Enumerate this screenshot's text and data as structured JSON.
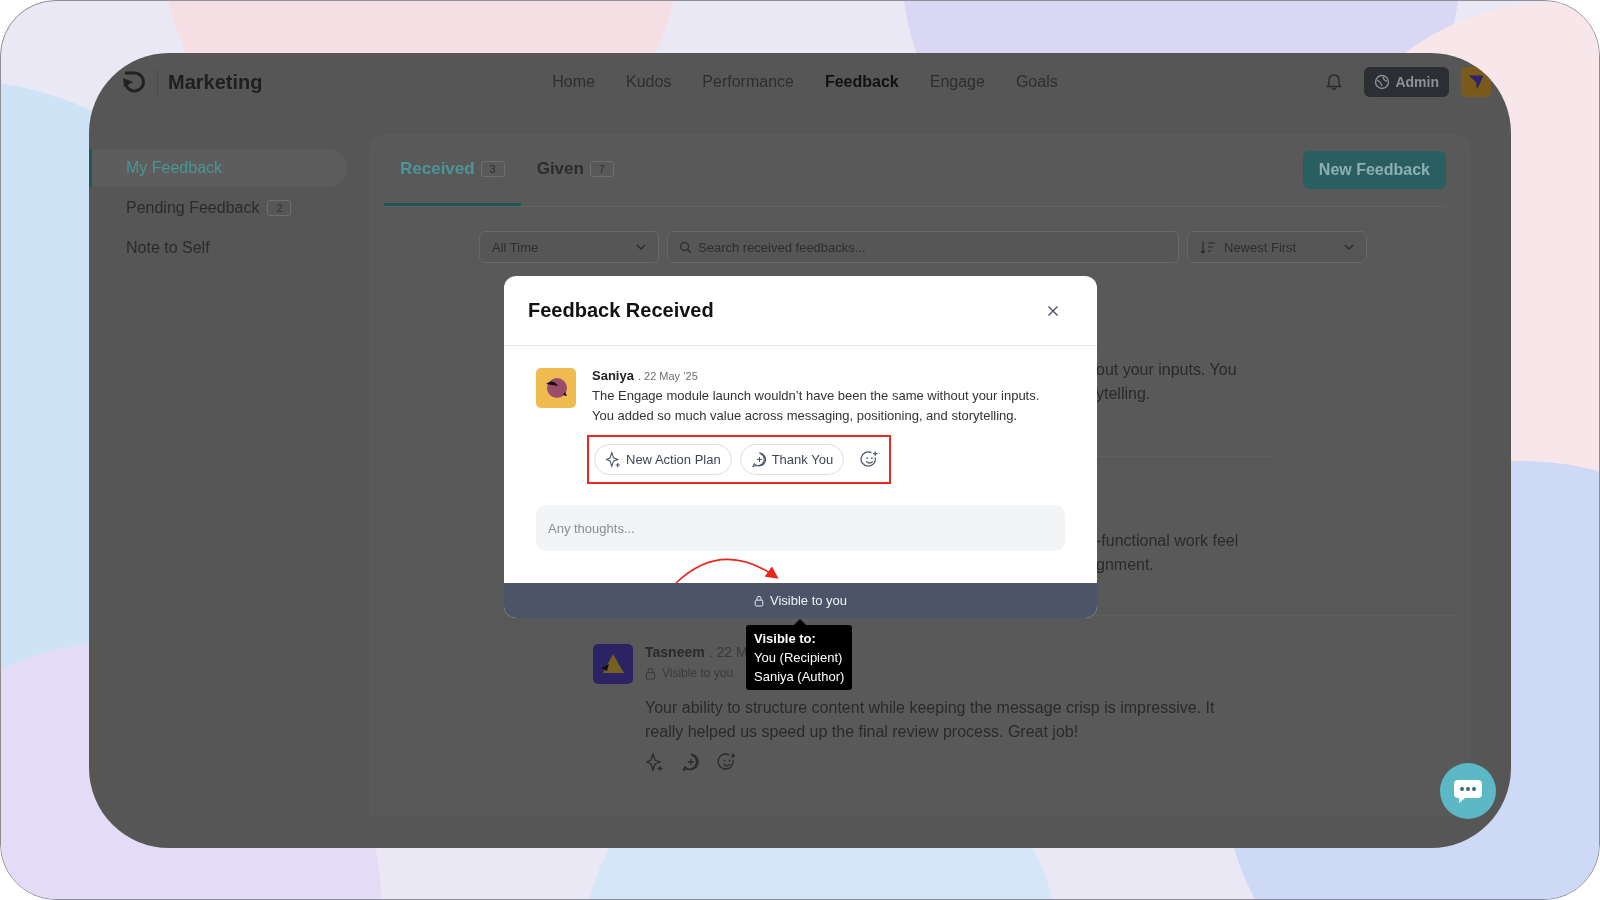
{
  "app": {
    "title": "Marketing",
    "admin_label": "Admin"
  },
  "nav": [
    {
      "label": "Home",
      "selected": false
    },
    {
      "label": "Kudos",
      "selected": false
    },
    {
      "label": "Performance",
      "selected": false
    },
    {
      "label": "Feedback",
      "selected": true
    },
    {
      "label": "Engage",
      "selected": false
    },
    {
      "label": "Goals",
      "selected": false
    }
  ],
  "sidebar": {
    "items": [
      {
        "label": "My Feedback",
        "selected": true
      },
      {
        "label": "Pending Feedback",
        "badge": "2",
        "selected": false
      },
      {
        "label": "Note to Self",
        "selected": false
      }
    ]
  },
  "tabs": [
    {
      "label": "Received",
      "count": "3",
      "selected": true
    },
    {
      "label": "Given",
      "count": "7",
      "selected": false
    }
  ],
  "new_feedback_button": "New Feedback",
  "filters": {
    "period": "All Time",
    "search_placeholder": "Search received feedbacks...",
    "sort": "Newest First"
  },
  "feed": {
    "fragments": [
      [
        "out your inputs. You",
        "ytelling."
      ],
      [
        "-functional work feel",
        "gnment."
      ]
    ],
    "item": {
      "author": "Tasneem",
      "date": ". 22 M",
      "visibility": "Visible to you",
      "text": "Your ability to structure content while keeping the message crisp is impressive. It really helped us speed up the final review process. Great job!"
    }
  },
  "modal": {
    "title": "Feedback Received",
    "author": "Saniya",
    "date": ". 22 May ’25",
    "text": "The Engage module launch wouldn’t have been the same without your inputs. You added so much value across messaging, positioning, and storytelling.",
    "actions": [
      "New Action Plan",
      "Thank You"
    ],
    "reply_placeholder": "Any thoughts...",
    "visibility": "Visible to you"
  },
  "tooltip": {
    "title": "Visible to:",
    "lines": [
      "You (Recipient)",
      "Saniya (Author)"
    ]
  }
}
